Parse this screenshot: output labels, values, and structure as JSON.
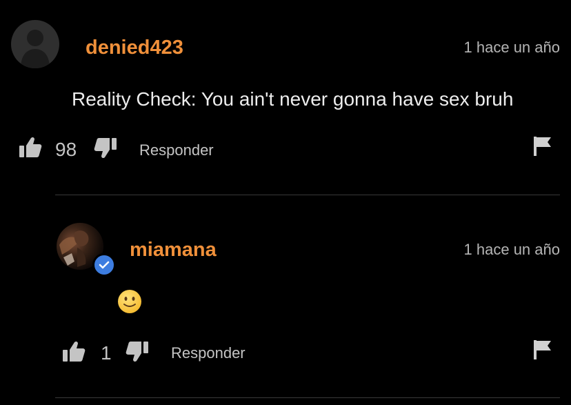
{
  "comments": [
    {
      "username": "denied423",
      "timestamp": "1 hace un año",
      "text": "Reality Check: You ain't never gonna have sex bruh",
      "likes": "98",
      "reply_label": "Responder",
      "avatar": "default-user-silhouette"
    },
    {
      "username": "miamana",
      "timestamp": "1 hace un año",
      "text_emoji": "slightly-smiling-face",
      "likes": "1",
      "reply_label": "Responder",
      "avatar": "user-photo",
      "verified": true
    }
  ],
  "icons": {
    "like": "thumbs-up-icon",
    "dislike": "thumbs-down-icon",
    "report": "flag-icon",
    "verified": "checkmark-icon"
  },
  "colors": {
    "background": "#000000",
    "username": "#f0903a",
    "verified_badge": "#3d7de0"
  }
}
